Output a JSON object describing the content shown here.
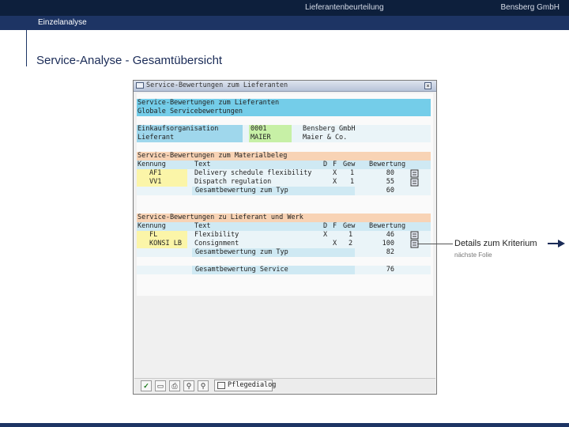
{
  "header": {
    "title": "Lieferantenbeurteilung",
    "company": "Bensberg GmbH",
    "subtitle": "Einzelanalyse"
  },
  "page": {
    "heading": "Service-Analyse - Gesamtübersicht"
  },
  "dialog": {
    "title": "Service-Bewertungen zum Lieferanten",
    "section1_header": "Service-Bewertungen zum Lieferanten",
    "section1_sub": "Globale Servicebewertungen",
    "org_label": "Einkaufsorganisation",
    "org_value": "0001",
    "org_name": "Bensberg GmbH",
    "vendor_label": "Lieferant",
    "vendor_value": "MAIER",
    "vendor_name": "Maier & Co.",
    "section2": {
      "header": "Service-Bewertungen zum Materialbeleg",
      "columns": {
        "kennung": "Kennung",
        "text": "Text",
        "d": "D",
        "f": "F",
        "gew": "Gew",
        "bewertung": "Bewertung"
      },
      "rows": [
        {
          "kennung": "AF1",
          "text": "Delivery schedule flexibility",
          "d": "X",
          "f": "",
          "gew": "1",
          "bewertung": "80"
        },
        {
          "kennung": "VV1",
          "text": "Dispatch regulation",
          "d": "X",
          "f": "",
          "gew": "1",
          "bewertung": "55"
        }
      ],
      "total_label": "Gesamtbewertung zum Typ",
      "total_value": "60"
    },
    "section3": {
      "header": "Service-Bewertungen zu Lieferant und Werk",
      "columns": {
        "kennung": "Kennung",
        "text": "Text",
        "d": "D",
        "f": "F",
        "gew": "Gew",
        "bewertung": "Bewertung"
      },
      "rows": [
        {
          "kennung": "FL",
          "text": "Flexibility",
          "d": "X",
          "f": "",
          "gew": "1",
          "bewertung": "46"
        },
        {
          "kennung": "KONSI LB",
          "text": "Consignment",
          "d": "",
          "f": "X",
          "gew": "2",
          "bewertung": "100"
        }
      ],
      "total_label": "Gesamtbewertung zum Typ",
      "total_value": "82"
    },
    "service_total_label": "Gesamtbewertung Service",
    "service_total_value": "76",
    "toolbar": {
      "fill_label": "Pflegedialog"
    }
  },
  "callout": {
    "main": "Details zum Kriterium",
    "sub": "nächste Folie"
  },
  "colors": {
    "title_bar": "#0d1f3c",
    "sub_bar": "#1d3464",
    "row_cyan": "#74cde9",
    "row_peach": "#f8d3b5",
    "cell_green": "#c7f0a6",
    "cell_yellow": "#fbf5a8"
  },
  "icons": [
    "window-icon",
    "close-icon",
    "details-icon",
    "check-icon",
    "save-icon",
    "print-icon",
    "find-icon",
    "find-next-icon",
    "maintenance-icon",
    "arrow-right-icon"
  ]
}
